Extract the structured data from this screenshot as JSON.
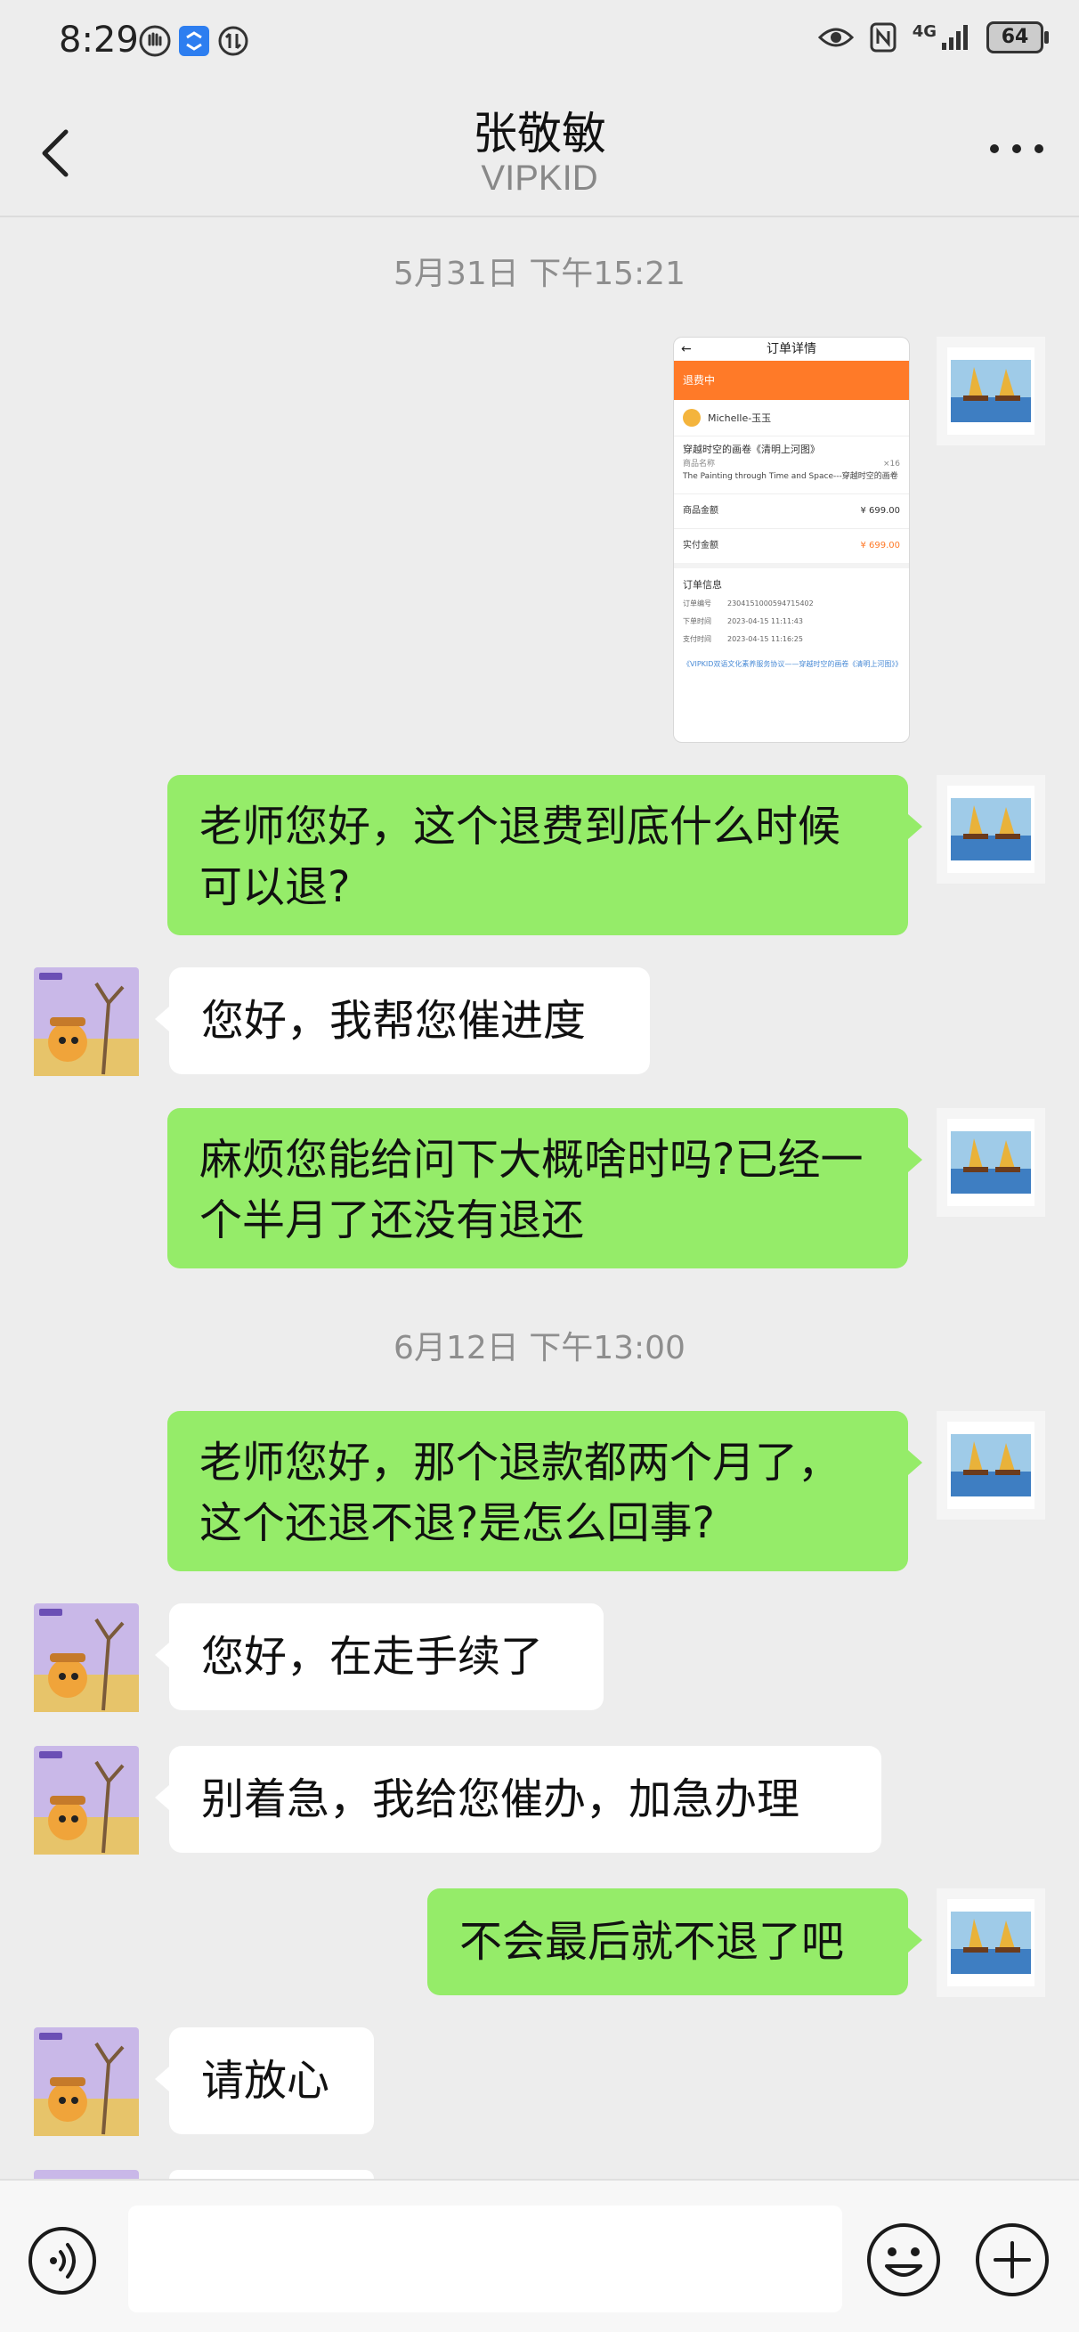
{
  "status_bar": {
    "time": "8:29",
    "network": "4G",
    "battery": "64"
  },
  "header": {
    "title": "张敬敏",
    "subtitle": "VIPKID"
  },
  "timestamps": [
    "5月31日 下午15:21",
    "6月12日 下午13:00"
  ],
  "order_screenshot": {
    "page_title": "订单详情",
    "status": "退费中",
    "user": "Michelle-玉玉",
    "product_title": "穿越时空的画卷《清明上河图》",
    "product_name_label": "商品名称",
    "product_name": "The Painting through Time and Space---穿越时空的画卷",
    "product_qty": "×16",
    "amount_label": "商品金额",
    "amount": "¥ 699.00",
    "paid_label": "实付金额",
    "paid": "¥ 699.00",
    "info_title": "订单信息",
    "order_no_label": "订单编号",
    "order_no": "2304151000594715402",
    "order_time_label": "下单时间",
    "order_time": "2023-04-15 11:11:43",
    "pay_time_label": "支付时间",
    "pay_time": "2023-04-15 11:16:25",
    "agreement": "《VIPKID双语文化素养服务协议——穿越时空的画卷《清明上河图》》"
  },
  "messages": [
    {
      "side": "me",
      "text": "老师您好，这个退费到底什么时候可以退?"
    },
    {
      "side": "them",
      "text": "您好，我帮您催进度"
    },
    {
      "side": "me",
      "text": "麻烦您能给问下大概啥时吗?已经一个半月了还没有退还"
    },
    {
      "side": "me",
      "text": "老师您好，那个退款都两个月了，这个还退不退?是怎么回事?"
    },
    {
      "side": "them",
      "text": "您好，在走手续了"
    },
    {
      "side": "them",
      "text": "别着急，我给您催办，加急办理"
    },
    {
      "side": "me",
      "text": "不会最后就不退了吧"
    },
    {
      "side": "them",
      "text": "请放心"
    }
  ],
  "colors": {
    "background": "#ededed",
    "my_bubble": "#95ec69",
    "their_bubble": "#ffffff",
    "accent_orange": "#ff7a28"
  },
  "icons": [
    "back-arrow-icon",
    "more-icon",
    "voice-icon",
    "emoji-icon",
    "plus-icon"
  ]
}
